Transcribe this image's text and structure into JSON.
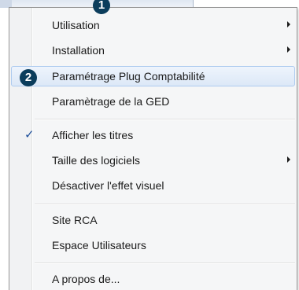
{
  "menu": {
    "items": [
      {
        "label": "Utilisation",
        "submenu": true
      },
      {
        "label": "Installation",
        "submenu": true
      },
      {
        "label": "Paramétrage Plug Comptabilité",
        "highlighted": true
      },
      {
        "label": "Paramètrage de la GED"
      },
      {
        "label": "Afficher les titres",
        "checked": true
      },
      {
        "label": "Taille des logiciels",
        "submenu": true
      },
      {
        "label": "Désactiver l'effet visuel"
      },
      {
        "label": "Site RCA"
      },
      {
        "label": "Espace Utilisateurs"
      },
      {
        "label": "A propos de..."
      }
    ],
    "check_glyph": "✓"
  },
  "callouts": {
    "first": "1",
    "second": "2"
  },
  "colors": {
    "badge": "#0b3d5c",
    "check": "#1d4f9a",
    "highlight_border": "#aecbef"
  }
}
